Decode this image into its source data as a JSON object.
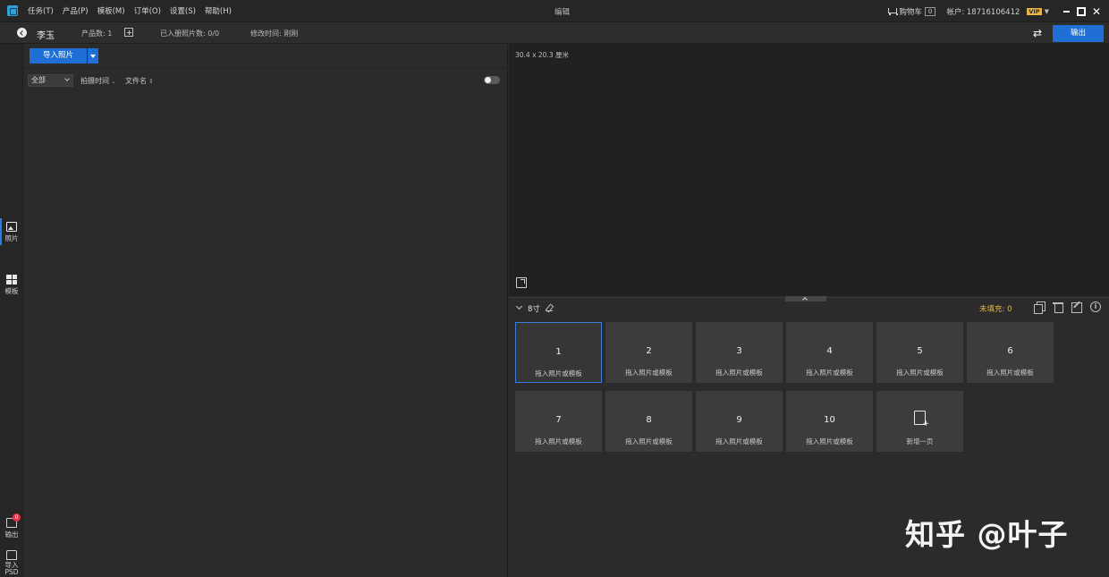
{
  "titlebar": {
    "menu": [
      "任务(T)",
      "产品(P)",
      "模板(M)",
      "订单(O)",
      "设置(S)",
      "帮助(H)"
    ],
    "window_title": "编辑",
    "cart_label": "购物车",
    "cart_count": "0",
    "account": "帐户: 18716106412",
    "vip": "VIP",
    "vip_caret": "▼"
  },
  "subbar": {
    "product_name": "李玉",
    "product_count": "产品数: 1",
    "in_album": "已入册照片数: 0/0",
    "modified": "修改时间: 刚刚",
    "export_label": "输出"
  },
  "rail": {
    "photos_label": "照片",
    "templates_label": "模板",
    "output_label": "输出",
    "output_badge": "0",
    "psd_label_1": "导入",
    "psd_label_2": "PSD"
  },
  "left_panel": {
    "import_label": "导入照片",
    "filter_value": "全部",
    "sort_time": "拍摄时间",
    "sort_name": "文件名"
  },
  "preview": {
    "size_label": "30.4 x 20.3 厘米"
  },
  "pages": {
    "size_name": "8寸",
    "unfilled": "未填充: 0",
    "tiles": [
      {
        "num": "1",
        "hint": "拖入照片或模板"
      },
      {
        "num": "2",
        "hint": "拖入照片或模板"
      },
      {
        "num": "3",
        "hint": "拖入照片或模板"
      },
      {
        "num": "4",
        "hint": "拖入照片或模板"
      },
      {
        "num": "5",
        "hint": "拖入照片或模板"
      },
      {
        "num": "6",
        "hint": "拖入照片或模板"
      },
      {
        "num": "7",
        "hint": "拖入照片或模板"
      },
      {
        "num": "8",
        "hint": "拖入照片或模板"
      },
      {
        "num": "9",
        "hint": "拖入照片或模板"
      },
      {
        "num": "10",
        "hint": "拖入照片或模板"
      }
    ],
    "new_page_label": "新增一页"
  },
  "watermark": "知乎 @叶子",
  "colors": {
    "accent": "#1f6fd6",
    "warning": "#e9b63c",
    "badge": "#e8334a"
  }
}
